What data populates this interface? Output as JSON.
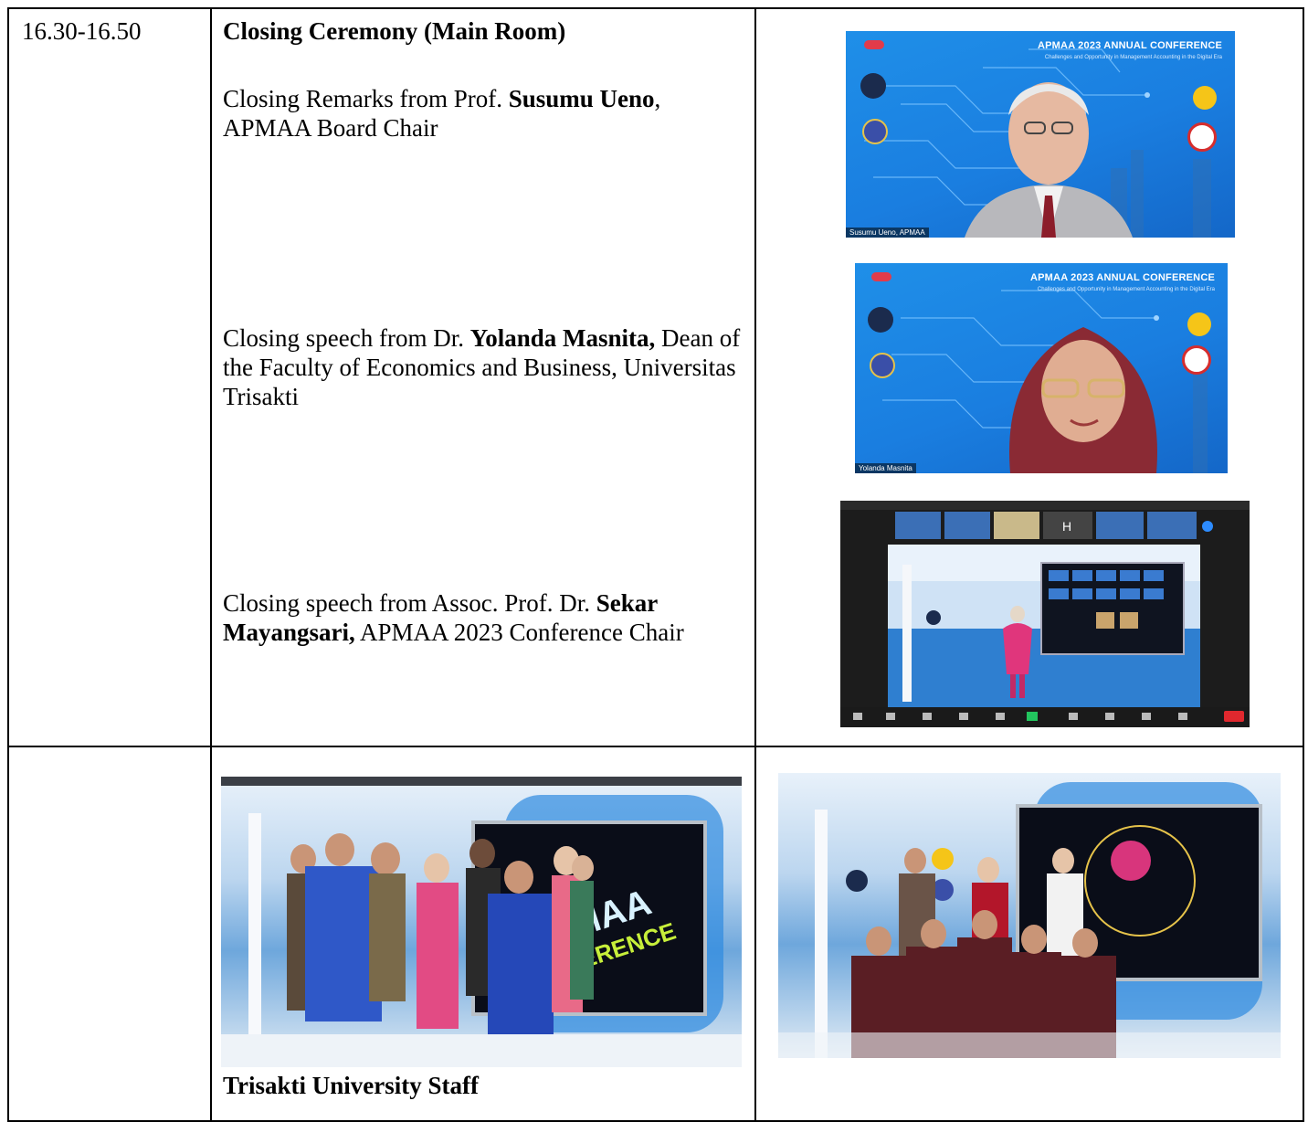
{
  "time_slot": "16.30-16.50",
  "session_title": "Closing Ceremony (Main Room)",
  "items": [
    {
      "prefix": "Closing Remarks from Prof. ",
      "name": "Susumu Ueno",
      "suffix": ", APMAA Board Chair"
    },
    {
      "prefix": "Closing speech from Dr. ",
      "name": "Yolanda Masnita,",
      "suffix": " Dean of the Faculty of Economics and Business, Universitas Trisakti"
    },
    {
      "prefix": "Closing speech from Assoc. Prof. Dr. ",
      "name": "Sekar Mayangsari,",
      "suffix": " APMAA 2023 Conference Chair"
    }
  ],
  "photos": {
    "conference_title": "APMAA 2023 ANNUAL CONFERENCE",
    "conference_subtitle": "Challenges and Opportunity in Management Accounting in the Digital Era",
    "speaker1_label": "Susumu Ueno, APMAA",
    "speaker2_label": "Yolanda Masnita",
    "screen_text_1": "APMAA",
    "screen_text_2": "CONFERENCE"
  },
  "staff_caption": "Trisakti University Staff",
  "colors": {
    "slide_blue": "#1a7ee0",
    "border": "#000000",
    "zoom_dark": "#1c1c1c"
  }
}
